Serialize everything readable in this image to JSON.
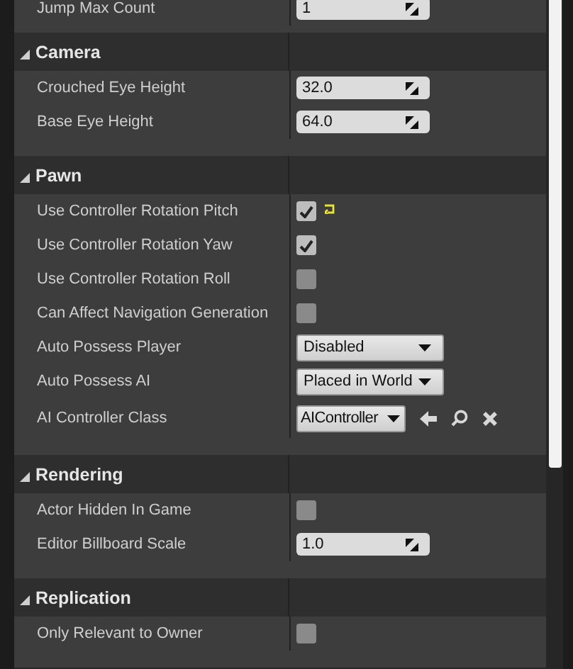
{
  "sections": [
    {
      "rows": [
        {
          "kind": "number",
          "label": "Jump Max Count",
          "value": "1"
        }
      ]
    },
    {
      "title": "Camera",
      "expanded": true,
      "rows": [
        {
          "kind": "number",
          "label": "Crouched Eye Height",
          "value": "32.0"
        },
        {
          "kind": "number",
          "label": "Base Eye Height",
          "value": "64.0"
        }
      ]
    },
    {
      "title": "Pawn",
      "expanded": true,
      "rows": [
        {
          "kind": "checkbox",
          "label": "Use Controller Rotation Pitch",
          "checked": true,
          "reset_available": true
        },
        {
          "kind": "checkbox",
          "label": "Use Controller Rotation Yaw",
          "checked": true,
          "reset_available": false
        },
        {
          "kind": "checkbox",
          "label": "Use Controller Rotation Roll",
          "checked": false,
          "reset_available": false
        },
        {
          "kind": "checkbox",
          "label": "Can Affect Navigation Generation",
          "checked": false,
          "reset_available": false
        },
        {
          "kind": "dropdown",
          "label": "Auto Possess Player",
          "value": "Disabled"
        },
        {
          "kind": "dropdown",
          "label": "Auto Possess AI",
          "value": "Placed in World"
        },
        {
          "kind": "class",
          "label": "AI Controller Class",
          "value": "AIController"
        }
      ]
    },
    {
      "title": "Rendering",
      "expanded": true,
      "rows": [
        {
          "kind": "checkbox",
          "label": "Actor Hidden In Game",
          "checked": false,
          "reset_available": false
        },
        {
          "kind": "number",
          "label": "Editor Billboard Scale",
          "value": "1.0"
        }
      ]
    },
    {
      "title": "Replication",
      "expanded": true,
      "rows": [
        {
          "kind": "checkbox",
          "label": "Only Relevant to Owner",
          "checked": false,
          "reset_available": false
        }
      ]
    }
  ]
}
